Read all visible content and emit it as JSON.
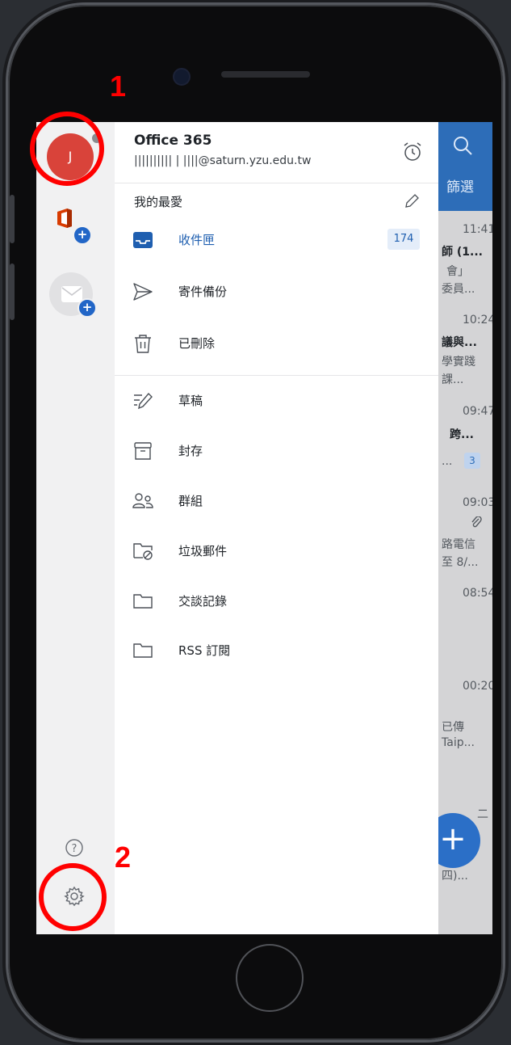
{
  "account": {
    "name": "Office 365",
    "email": "|||||||||| | ||||@saturn.yzu.edu.tw",
    "avatar_initial": "J"
  },
  "favorites": {
    "label": "我的最愛",
    "items": [
      {
        "label": "收件匣",
        "icon": "inbox-icon",
        "count": "174",
        "active": true
      },
      {
        "label": "寄件備份",
        "icon": "send-icon"
      },
      {
        "label": "已刪除",
        "icon": "trash-icon"
      }
    ]
  },
  "folders": [
    {
      "label": "草稿",
      "icon": "draft-icon"
    },
    {
      "label": "封存",
      "icon": "archive-icon"
    },
    {
      "label": "群組",
      "icon": "groups-icon"
    },
    {
      "label": "垃圾郵件",
      "icon": "junk-folder-icon"
    },
    {
      "label": "交談記錄",
      "icon": "folder-icon"
    },
    {
      "label": "RSS 訂閱",
      "icon": "folder-icon"
    }
  ],
  "background_mail": {
    "filter_label": "篩選",
    "fragments": [
      "11:41",
      "師 (1...",
      "會」",
      "委員...",
      "10:24",
      "議與...",
      "學實踐",
      "課...",
      "09:47",
      "跨...",
      "...",
      "09:03",
      "路電信",
      "至 8/...",
      "08:54",
      "00:20",
      "已傳",
      "Taip...",
      "二",
      "四)..."
    ],
    "unread_badge": "3"
  },
  "annotations": {
    "marker_1": "1",
    "marker_2": "2"
  },
  "colors": {
    "accent": "#1f5fb0",
    "avatar": "#d9433a",
    "annotation": "#ff0000",
    "header_blue": "#2d6db8"
  }
}
